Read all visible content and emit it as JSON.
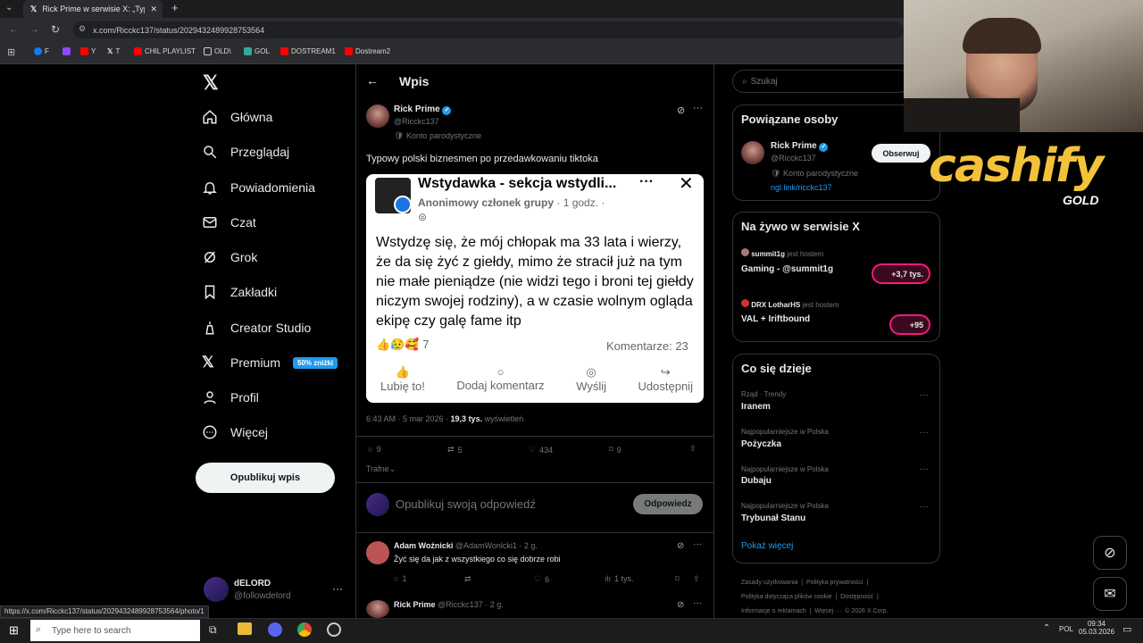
{
  "browser": {
    "tab_title": "Rick Prime w serwisie X: „Typow",
    "url": "x.com/Ricckc137/status/2029432489928753564",
    "bookmarks": [
      "F",
      "Y",
      "T",
      "CHIL PLAYLIST",
      "OLD\\",
      "GOL",
      "DOSTREAM1",
      "Dostream2"
    ],
    "status_url": "https://x.com/Ricckc137/status/2029432489928753564/photo/1"
  },
  "nav": {
    "items": [
      "Główna",
      "Przeglądaj",
      "Powiadomienia",
      "Czat",
      "Grok",
      "Zakładki",
      "Creator Studio",
      "Premium",
      "Profil",
      "Więcej"
    ],
    "premium_badge": "50% zniżki",
    "publish": "Opublikuj wpis",
    "account_name": "dELORD",
    "account_handle": "@followdelord"
  },
  "post": {
    "header": "Wpis",
    "author": "Rick Prime",
    "handle": "@Ricckc137",
    "label": "Konto parodystyczne",
    "text": "Typowy polski biznesmen po przedawkowaniu tiktoka",
    "time": "6:43 AM · 5 mar 2026 · ",
    "views": "19,3 tys.",
    "views_label": "wyświetleń",
    "replies": "9",
    "reposts": "5",
    "likes": "434",
    "bookmarks": "9",
    "sort": "Trafne",
    "reply_placeholder": "Opublikuj swoją odpowiedź",
    "reply_button": "Odpowiedz"
  },
  "fb": {
    "group": "Wstydawka - sekcja wstydli...",
    "member": "Anonimowy członek grupy",
    "time": "· 1 godz. ·",
    "body": "Wstydzę się, że mój chłopak ma 33 lata i wierzy, że da się żyć z giełdy, mimo że stracił już na tym nie małe pieniądze (nie widzi tego i broni tej giełdy niczym swojej rodziny), a w czasie wolnym ogląda ekipę czy galę fame itp",
    "reactions": "7",
    "comments": "Komentarze: 23",
    "actions": [
      "Lubię to!",
      "Dodaj komentarz",
      "Wyślij",
      "Udostępnij"
    ]
  },
  "replies": [
    {
      "name": "Adam Woźnicki",
      "handle": "@AdamWonlcki1 · 2 g.",
      "text": "Żyć się da jak z wszystkiego co się dobrze robi",
      "replies": "1",
      "likes": "6",
      "views": "1 tys."
    },
    {
      "name": "Rick Prime",
      "handle": "@Ricckc137 · 2 g.",
      "text": ""
    }
  ],
  "sidebar": {
    "search_placeholder": "Szukaj",
    "related_title": "Powiązane osoby",
    "related_name": "Rick Prime",
    "related_handle": "@Ricckc137",
    "related_label": "Konto parodystyczne",
    "related_link": "ngl.link/ricckc137",
    "follow": "Obserwuj",
    "live_title": "Na żywo w serwisie X",
    "live": [
      {
        "host": "summit1g",
        "host_suffix": "jest hostem",
        "title": "Gaming - @summit1g",
        "count": "+3,7 tys."
      },
      {
        "host": "DRX LotharHS",
        "host_suffix": "jest hostem",
        "title": "VAL + Iriftbound",
        "count": "+95"
      }
    ],
    "trends_title": "Co się dzieje",
    "trends": [
      {
        "meta": "Rząd · Trendy",
        "name": "Iranem"
      },
      {
        "meta": "Najpopularniejsze w Polska",
        "name": "Pożyczka"
      },
      {
        "meta": "Najpopularniejsze w Polska",
        "name": "Dubaju"
      },
      {
        "meta": "Najpopularniejsze w Polska",
        "name": "Trybunał Stanu"
      }
    ],
    "show_more": "Pokaż więcej",
    "footer": [
      "Zasady użytkowania",
      "Polityka prywatności",
      "Polityka dotycząca plików cookie",
      "Dostępność",
      "Informacje o reklamach",
      "Więcej ···",
      "© 2026 X Corp."
    ]
  },
  "overlay": {
    "brand": "cashify",
    "brand_sub": "GOLD"
  },
  "taskbar": {
    "search": "Type here to search",
    "lang": "POL",
    "time": "09:34",
    "date": "05.03.2026"
  }
}
